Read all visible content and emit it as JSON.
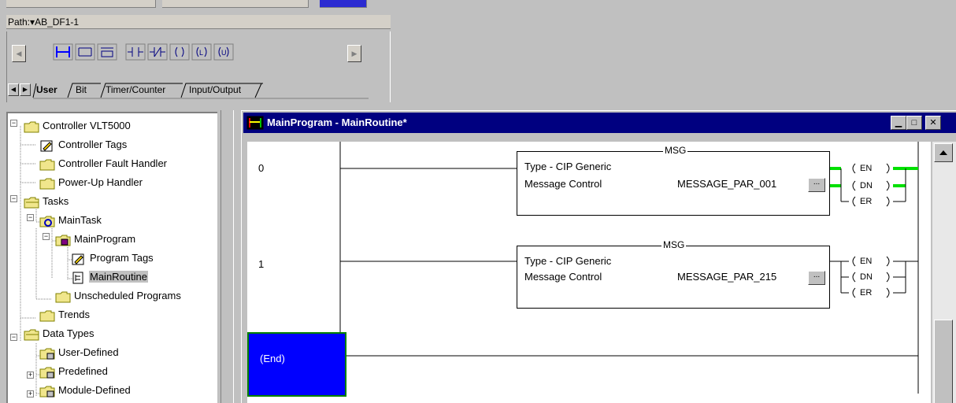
{
  "path_bar": {
    "label": "Path:",
    "value": "AB_DF1-1"
  },
  "instruction_tabs": [
    {
      "label": "User",
      "active": true
    },
    {
      "label": "Bit",
      "active": false
    },
    {
      "label": "Timer/Counter",
      "active": false
    },
    {
      "label": "Input/Output",
      "active": false
    }
  ],
  "tree": {
    "items": [
      {
        "label": "Controller VLT5000",
        "icon": "folder-icon"
      },
      {
        "label": "Controller Tags",
        "icon": "tags-icon"
      },
      {
        "label": "Controller Fault Handler",
        "icon": "folder-icon"
      },
      {
        "label": "Power-Up Handler",
        "icon": "folder-icon"
      },
      {
        "label": "Tasks",
        "icon": "folder-icon"
      },
      {
        "label": "MainTask",
        "icon": "task-icon"
      },
      {
        "label": "MainProgram",
        "icon": "program-icon"
      },
      {
        "label": "Program Tags",
        "icon": "tags-icon"
      },
      {
        "label": "MainRoutine",
        "icon": "routine-icon"
      },
      {
        "label": "Unscheduled Programs",
        "icon": "folder-icon"
      },
      {
        "label": "Trends",
        "icon": "folder-icon"
      },
      {
        "label": "Data Types",
        "icon": "folder-icon"
      },
      {
        "label": "User-Defined",
        "icon": "datatype-icon"
      },
      {
        "label": "Predefined",
        "icon": "datatype-icon"
      },
      {
        "label": "Module-Defined",
        "icon": "datatype-icon"
      }
    ]
  },
  "ladder_window": {
    "title": "MainProgram - MainRoutine*",
    "rungs": [
      {
        "number": "0",
        "instruction": "MSG",
        "type_line": "Type - CIP Generic",
        "control_label": "Message Control",
        "control_tag": "MESSAGE_PAR_001",
        "outputs": [
          "EN",
          "DN",
          "ER"
        ]
      },
      {
        "number": "1",
        "instruction": "MSG",
        "type_line": "Type - CIP Generic",
        "control_label": "Message Control",
        "control_tag": "MESSAGE_PAR_215",
        "outputs": [
          "EN",
          "DN",
          "ER"
        ]
      }
    ],
    "end_label": "(End)",
    "browse_button": "..."
  },
  "colors": {
    "title_bar": "#000080",
    "end_block": "#0000ff",
    "energized": "#00e000"
  }
}
